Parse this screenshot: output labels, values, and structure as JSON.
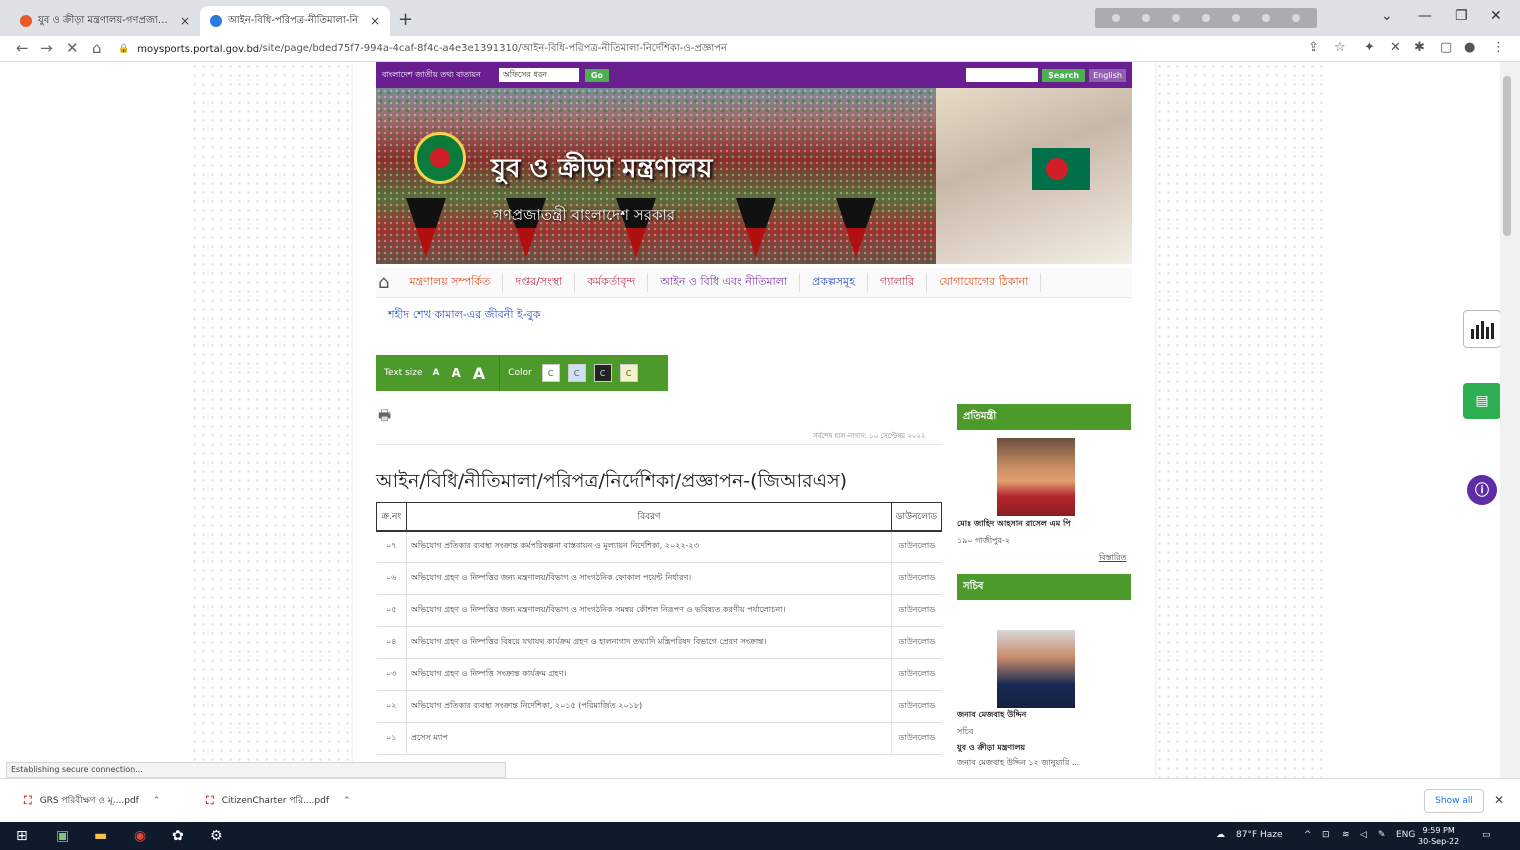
{
  "browser": {
    "tabs": [
      {
        "title": "যুব ও ক্রীড়া মন্ত্রণালয়-গণপ্রজাতন্ত্রী",
        "active": false
      },
      {
        "title": "আইন-বিধি-পরিপত্র-নীতিমালা-নি",
        "active": true
      }
    ],
    "url_host": "moysports.portal.gov.bd",
    "url_path": "/site/page/bded75f7-994a-4caf-8f4c-a4e3e1391310/আইন-বিধি-পরিপত্র-নীতিমালা-নির্দেশিকা-ও-প্রজ্ঞাপন",
    "status_text": "Establishing secure connection..."
  },
  "site": {
    "portal_label": "বাংলাদেশ জাতীয় তথ্য বাতায়ন",
    "office_select": "অফিসের ধরন",
    "go_label": "Go",
    "search_label": "Search",
    "english_label": "English",
    "ministry_name": "যুব ও ক্রীড়া মন্ত্রণালয়",
    "govt_name": "গণপ্রজাতন্ত্রী বাংলাদেশ সরকার"
  },
  "menu": {
    "items": [
      {
        "label": "মন্ত্রণালয় সম্পর্কিত",
        "color": "#e0552b"
      },
      {
        "label": "দপ্তর/সংস্থা",
        "color": "#c43b5a"
      },
      {
        "label": "কর্মকর্তাবৃন্দ",
        "color": "#c43b5a"
      },
      {
        "label": "আইন ও বিধি এবং নীতিমালা",
        "color": "#7b3aa6"
      },
      {
        "label": "প্রকল্পসমূহ",
        "color": "#2b55c4"
      },
      {
        "label": "গ্যালারি",
        "color": "#c43b5a"
      },
      {
        "label": "যোগাযোগের ঠিকানা",
        "color": "#e0552b"
      }
    ],
    "sub_item": "শহীদ শেখ কামাল-এর জীবনী ই-বুক"
  },
  "toolbar": {
    "text_size_label": "Text size",
    "size_small": "A",
    "size_medium": "A",
    "size_large": "A",
    "color_label": "Color",
    "swatches": [
      {
        "label": "C",
        "bg": "#ffffff"
      },
      {
        "label": "C",
        "bg": "#cfe0f5"
      },
      {
        "label": "C",
        "bg": "#222222"
      },
      {
        "label": "C",
        "bg": "#f5f2c8"
      }
    ]
  },
  "main": {
    "updated": "সর্বশেষ হাল-নাগাদ: ১০ সেপ্টেম্বর ২০২২",
    "title": "আইন/বিধি/নীতিমালা/পরিপত্র/নির্দেশিকা/প্রজ্ঞাপন-(জিআরএস)",
    "table_headers": {
      "no": "ক্র.নং",
      "desc": "বিবরণ",
      "download": "ডাউনলোড"
    },
    "rows": [
      {
        "no": "০৭",
        "desc": "অভিযোগ প্রতিকার ব্যবস্থা সংক্রান্ত কর্মপরিকল্পনা বাস্তবায়ন ও মূল্যায়ন নির্দেশিকা, ২০২২-২৩",
        "download": "ডাউনলোড"
      },
      {
        "no": "০৬",
        "desc": "অভিযোগ গ্রহণ ও নিষ্পত্তির জন্য মন্ত্রণালয়/বিভাগ ও সাংগঠনিক ফোকাল পয়েন্ট নির্ধারণ।",
        "download": "ডাউনলোড"
      },
      {
        "no": "০৫",
        "desc": "অভিযোগ গ্রহণ ও নিষ্পত্তির জন্য মন্ত্রণালয়/বিভাগ ও সাংগঠনিক সমন্বয় কৌশল নিরূপণ ও ভবিষ্যত করণীয় পর্যালোচনা।",
        "download": "ডাউনলোড"
      },
      {
        "no": "০৪",
        "desc": "অভিযোগ গ্রহণ ও নিষ্পত্তির বিষয়ে যথাযথ কার্যক্রম গ্রহণ ও হালনাগাদ তথ্যাদি মন্ত্রিপরিষদ বিভাগে প্রেরণ সংক্রান্ত।",
        "download": "ডাউনলোড"
      },
      {
        "no": "০৩",
        "desc": "অভিযোগ গ্রহণ ও নিষ্পত্তি সংক্রান্ত কার্যক্রম গ্রহণ।",
        "download": "ডাউনলোড"
      },
      {
        "no": "০২",
        "desc": "অভিযোগ প্রতিকার ব্যবস্থা সংক্রান্ত নির্দেশিকা, ২০১৫ (পরিমার্জিত ২০১৮)",
        "download": "ডাউনলোড"
      },
      {
        "no": "০১",
        "desc": "প্রসেস ম্যাপ",
        "download": "ডাউনলোড"
      }
    ]
  },
  "sidebar": {
    "minister_head": "প্রতিমন্ত্রী",
    "minister_name": "মোঃ জাহিদ আহসান রাসেল এম পি",
    "minister_const": "১৯০ গাজীপুর-২",
    "minister_more": "বিস্তারিত",
    "secretary_head": "সচিব",
    "secretary_name": "জনাব মেজবাহ উদ্দিন",
    "secretary_title": "সচিব",
    "secretary_ministry": "যুব ও ক্রীড়া মন্ত্রণালয়",
    "secretary_note": "জনাব মেজবাহ উদ্দিন ১২ জানুয়ারি ..."
  },
  "downloads": {
    "items": [
      "GRS পরিবীক্ষণ ও মূ....pdf",
      "CitizenCharter পরি....pdf"
    ],
    "show_all": "Show all"
  },
  "taskbar": {
    "weather": "87°F  Haze",
    "lang": "ENG",
    "time": "9:59 PM",
    "date": "30-Sep-22"
  }
}
